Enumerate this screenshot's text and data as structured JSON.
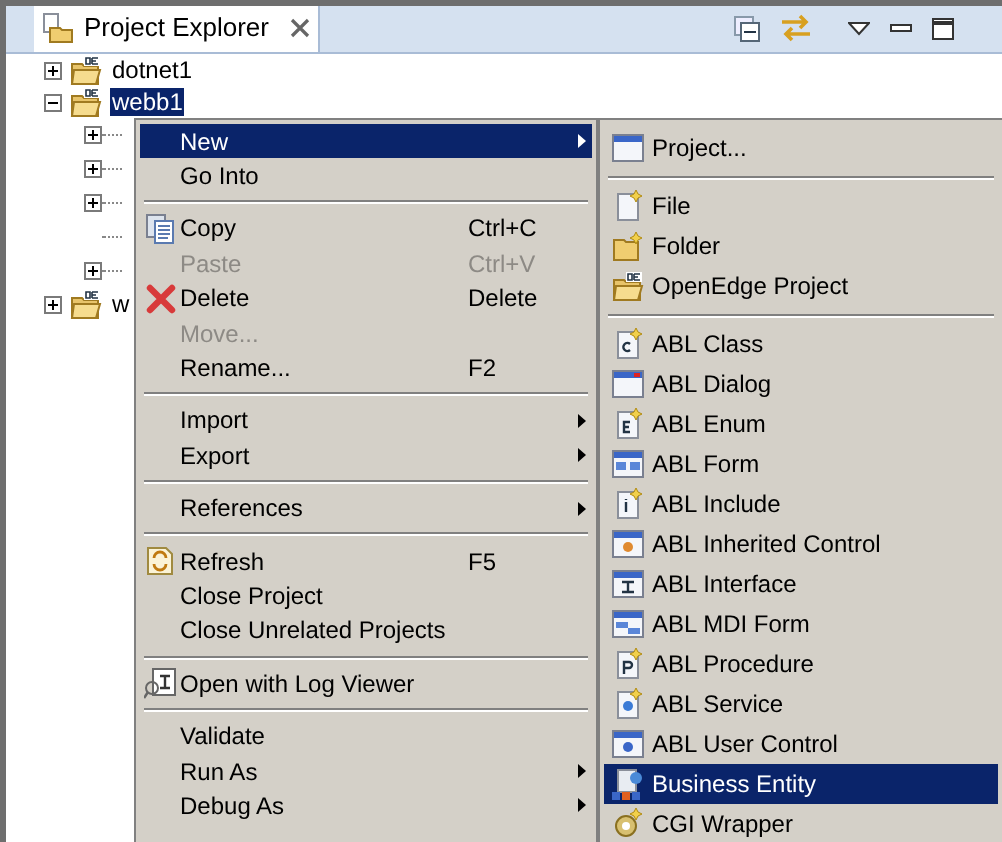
{
  "view_tab": {
    "title": "Project Explorer",
    "selected": true
  },
  "tree": [
    {
      "label": "dotnet1",
      "expanded": false,
      "selected": false
    },
    {
      "label": "webb1",
      "expanded": true,
      "selected": true,
      "children": [
        {
          "expandable": true
        },
        {
          "expandable": true
        },
        {
          "expandable": true
        },
        {
          "expandable": false
        },
        {
          "expandable": true
        }
      ]
    },
    {
      "label": "w",
      "expanded": false,
      "selected": false
    }
  ],
  "context_menu": [
    {
      "kind": "item",
      "label": "New",
      "submenu": true,
      "selected": true,
      "disabled": false
    },
    {
      "kind": "item",
      "label": "Go Into",
      "submenu": false,
      "selected": false,
      "disabled": false
    },
    {
      "kind": "separator"
    },
    {
      "kind": "item",
      "label": "Copy",
      "shortcut": "Ctrl+C",
      "submenu": false,
      "selected": false,
      "disabled": false
    },
    {
      "kind": "item",
      "label": "Paste",
      "shortcut": "Ctrl+V",
      "submenu": false,
      "selected": false,
      "disabled": true
    },
    {
      "kind": "item",
      "label": "Delete",
      "shortcut": "Delete",
      "submenu": false,
      "selected": false,
      "disabled": false
    },
    {
      "kind": "item",
      "label": "Move...",
      "submenu": false,
      "selected": false,
      "disabled": true
    },
    {
      "kind": "item",
      "label": "Rename...",
      "shortcut": "F2",
      "submenu": false,
      "selected": false,
      "disabled": false
    },
    {
      "kind": "separator"
    },
    {
      "kind": "item",
      "label": "Import",
      "submenu": true,
      "selected": false,
      "disabled": false
    },
    {
      "kind": "item",
      "label": "Export",
      "submenu": true,
      "selected": false,
      "disabled": false
    },
    {
      "kind": "separator"
    },
    {
      "kind": "item",
      "label": "References",
      "submenu": true,
      "selected": false,
      "disabled": false
    },
    {
      "kind": "separator"
    },
    {
      "kind": "item",
      "label": "Refresh",
      "shortcut": "F5",
      "submenu": false,
      "selected": false,
      "disabled": false
    },
    {
      "kind": "item",
      "label": "Close Project",
      "submenu": false,
      "selected": false,
      "disabled": false
    },
    {
      "kind": "item",
      "label": "Close Unrelated Projects",
      "submenu": false,
      "selected": false,
      "disabled": false
    },
    {
      "kind": "separator"
    },
    {
      "kind": "item",
      "label": "Open with Log Viewer",
      "submenu": false,
      "selected": false,
      "disabled": false
    },
    {
      "kind": "separator"
    },
    {
      "kind": "item",
      "label": "Validate",
      "submenu": false,
      "selected": false,
      "disabled": false
    },
    {
      "kind": "item",
      "label": "Run As",
      "submenu": true,
      "selected": false,
      "disabled": false
    },
    {
      "kind": "item",
      "label": "Debug As",
      "submenu": true,
      "selected": false,
      "disabled": false
    }
  ],
  "new_submenu": [
    {
      "kind": "item",
      "label": "Project...",
      "selected": false
    },
    {
      "kind": "separator"
    },
    {
      "kind": "item",
      "label": "File",
      "selected": false
    },
    {
      "kind": "item",
      "label": "Folder",
      "selected": false
    },
    {
      "kind": "item",
      "label": "OpenEdge Project",
      "selected": false
    },
    {
      "kind": "separator"
    },
    {
      "kind": "item",
      "label": "ABL Class",
      "selected": false
    },
    {
      "kind": "item",
      "label": "ABL Dialog",
      "selected": false
    },
    {
      "kind": "item",
      "label": "ABL Enum",
      "selected": false
    },
    {
      "kind": "item",
      "label": "ABL Form",
      "selected": false
    },
    {
      "kind": "item",
      "label": "ABL Include",
      "selected": false
    },
    {
      "kind": "item",
      "label": "ABL Inherited Control",
      "selected": false
    },
    {
      "kind": "item",
      "label": "ABL Interface",
      "selected": false
    },
    {
      "kind": "item",
      "label": "ABL MDI Form",
      "selected": false
    },
    {
      "kind": "item",
      "label": "ABL Procedure",
      "selected": false
    },
    {
      "kind": "item",
      "label": "ABL Service",
      "selected": false
    },
    {
      "kind": "item",
      "label": "ABL User Control",
      "selected": false
    },
    {
      "kind": "item",
      "label": "Business Entity",
      "selected": true
    },
    {
      "kind": "item",
      "label": "CGI Wrapper",
      "selected": false
    }
  ]
}
